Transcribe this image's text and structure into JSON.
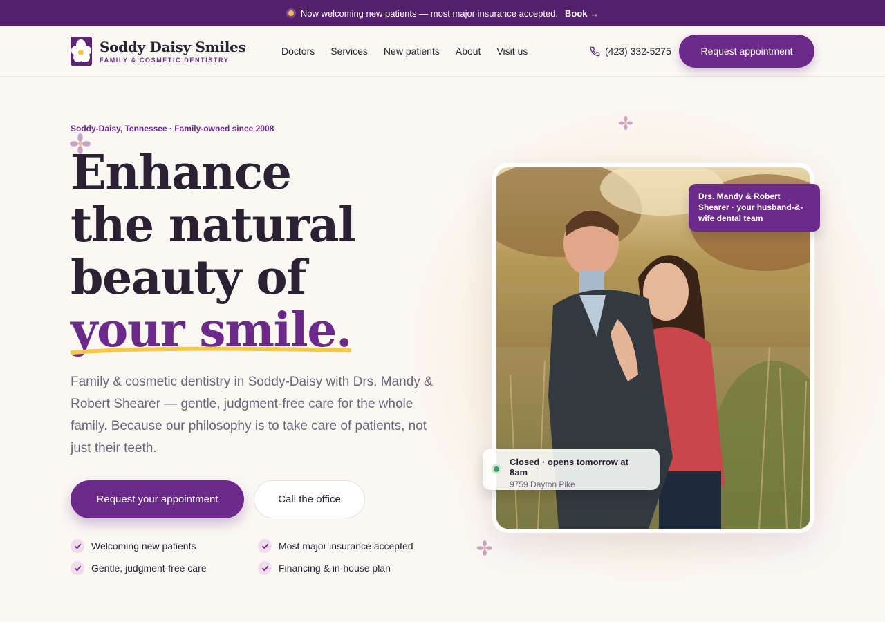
{
  "announcement": {
    "text": "Now welcoming new patients — most major insurance accepted.",
    "link": "Book →"
  },
  "brand": {
    "name": "Soddy Daisy Smiles",
    "tagline": "FAMILY & COSMETIC DENTISTRY"
  },
  "nav": {
    "items": [
      {
        "label": "Doctors"
      },
      {
        "label": "Services"
      },
      {
        "label": "New patients"
      },
      {
        "label": "About"
      },
      {
        "label": "Visit us"
      }
    ],
    "phone": "(423) 332-5275",
    "cta": "Request appointment"
  },
  "hero": {
    "eyebrow": "Soddy-Daisy, Tennessee · Family-owned since 2008",
    "headline_line1": "Enhance",
    "headline_line2": "the natural",
    "headline_line3": "beauty of",
    "headline_highlight": "your smile.",
    "lede": "Family & cosmetic dentistry in Soddy-Daisy with Drs. Mandy & Robert Shearer — gentle, judgment-free care for the whole family. Because our philosophy is to take care of patients, not just their teeth.",
    "primary_cta": "Request your appointment",
    "secondary_cta": "Call the office",
    "features": [
      "Welcoming new patients",
      "Most major insurance accepted",
      "Gentle, judgment-free care",
      "Financing & in-house plan"
    ]
  },
  "photo": {
    "caption": "Drs. Mandy & Robert Shearer · your husband-&-wife dental team",
    "status_main": "Closed · opens tomorrow at 8am",
    "status_address": "9759 Dayton Pike"
  },
  "colors": {
    "brand_purple": "#6b2a8a",
    "banner_purple": "#54206b",
    "accent_yellow": "#f2c94c",
    "open_green": "#3f9a63",
    "background": "#fbf8f4"
  }
}
